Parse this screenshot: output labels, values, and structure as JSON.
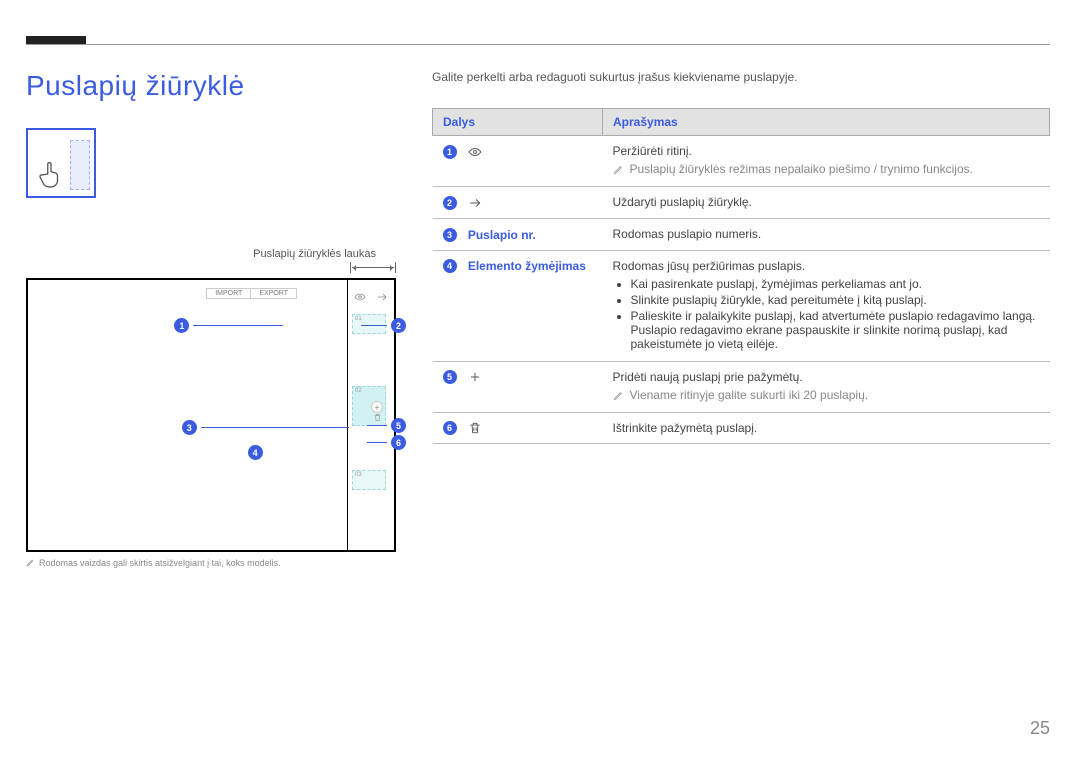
{
  "title": "Puslapių žiūryklė",
  "gesture_caption": "Puslapių žiūryklės laukas",
  "footnote_left": "Rodomas vaizdas gali skirtis atsižvelgiant į tai, koks modelis.",
  "intro": "Galite perkelti arba redaguoti sukurtus įrašus kiekviename puslapyje.",
  "page_number": "25",
  "screenshot": {
    "import": "IMPORT",
    "export": "EXPORT",
    "thumbs": [
      "01",
      "02",
      "03"
    ]
  },
  "table": {
    "headers": {
      "parts": "Dalys",
      "description": "Aprašymas"
    },
    "rows": [
      {
        "num": "1",
        "icon": "eye",
        "label": "",
        "desc_main": "Peržiūrėti ritinį.",
        "note": "Puslapių žiūryklės režimas nepalaiko piešimo / trynimo funkcijos."
      },
      {
        "num": "2",
        "icon": "arrow-right",
        "label": "",
        "desc_main": "Uždaryti puslapių žiūryklę."
      },
      {
        "num": "3",
        "icon": "",
        "label": "Puslapio nr.",
        "desc_main": "Rodomas puslapio numeris."
      },
      {
        "num": "4",
        "icon": "",
        "label": "Elemento žymėjimas",
        "desc_main": "Rodomas jūsų peržiūrimas puslapis.",
        "bullets": [
          "Kai pasirenkate puslapį, žymėjimas perkeliamas ant jo.",
          "Slinkite puslapių žiūrykle, kad pereitumėte į kitą puslapį.",
          "Palieskite ir palaikykite puslapį, kad atvertumėte puslapio redagavimo langą. Puslapio redagavimo ekrane paspauskite ir slinkite norimą puslapį, kad pakeistumėte jo vietą eilėje."
        ]
      },
      {
        "num": "5",
        "icon": "plus",
        "label": "",
        "desc_main": "Pridėti naują puslapį prie pažymėtų.",
        "note": "Viename ritinyje galite sukurti iki 20 puslapių."
      },
      {
        "num": "6",
        "icon": "trash",
        "label": "",
        "desc_main": "Ištrinkite pažymėtą puslapį."
      }
    ]
  }
}
